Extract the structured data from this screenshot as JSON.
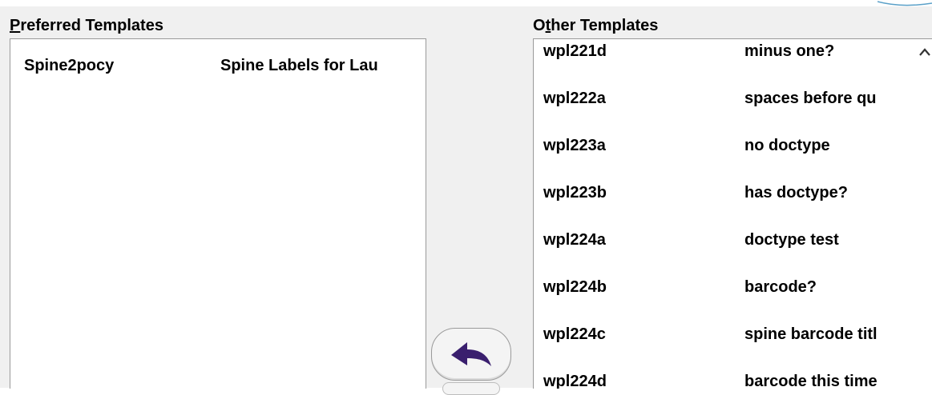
{
  "preferred": {
    "label_first": "P",
    "label_rest": "referred Templates",
    "rows": [
      {
        "code": "Spine2pocy",
        "desc": "Spine Labels for Lau"
      }
    ]
  },
  "other": {
    "label_first": "O",
    "label_mid": "t",
    "label_rest": "her Templates",
    "rows": [
      {
        "code": "wpl221d",
        "desc": "minus one?"
      },
      {
        "code": "wpl222a",
        "desc": "spaces before qu"
      },
      {
        "code": "wpl223a",
        "desc": "no doctype"
      },
      {
        "code": "wpl223b",
        "desc": "has doctype?"
      },
      {
        "code": "wpl224a",
        "desc": "doctype test"
      },
      {
        "code": "wpl224b",
        "desc": "barcode?"
      },
      {
        "code": "wpl224c",
        "desc": "spine barcode titl"
      },
      {
        "code": "wpl224d",
        "desc": "barcode this time"
      }
    ]
  },
  "icons": {
    "move_left": "arrow-back-icon",
    "scroll_up": "chevron-up-icon"
  },
  "colors": {
    "arrow": "#3a1f6e"
  }
}
